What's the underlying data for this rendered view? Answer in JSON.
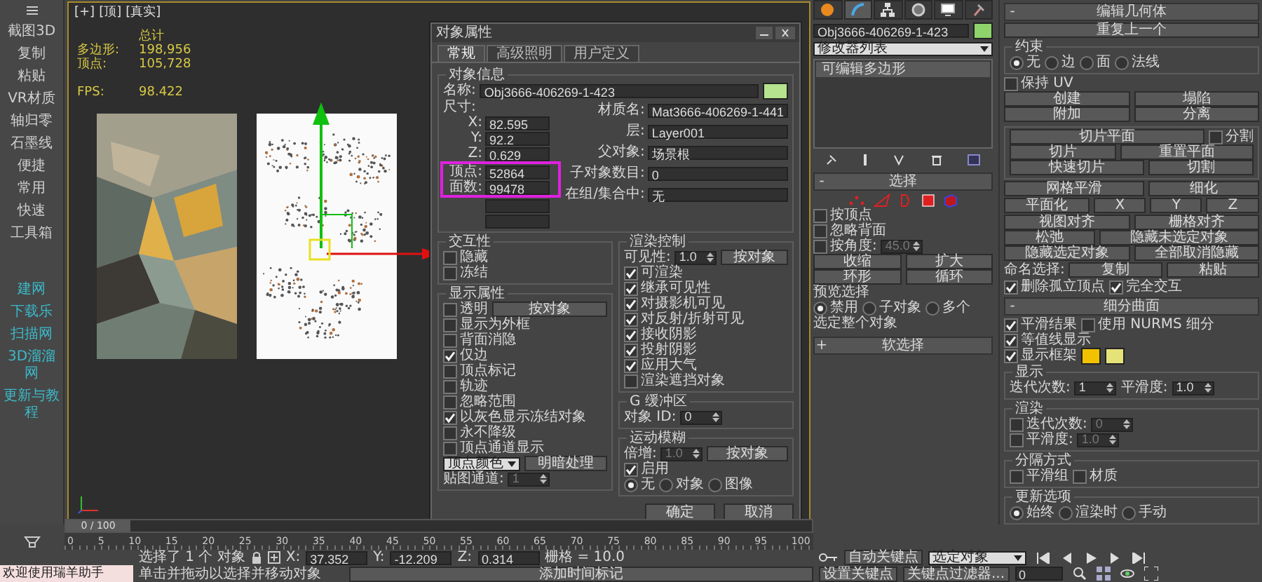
{
  "sidebar": {
    "items": [
      {
        "label": "截图3D",
        "kind": "tool"
      },
      {
        "label": "复制",
        "kind": "tool"
      },
      {
        "label": "粘贴",
        "kind": "tool"
      },
      {
        "label": "VR材质",
        "kind": "tool"
      },
      {
        "label": "轴归零",
        "kind": "tool"
      },
      {
        "label": "石墨线",
        "kind": "tool"
      },
      {
        "label": "便捷",
        "kind": "tool"
      },
      {
        "label": "常用",
        "kind": "tool"
      },
      {
        "label": "快速",
        "kind": "tool"
      },
      {
        "label": "工具箱",
        "kind": "tool"
      },
      {
        "label": "建网",
        "kind": "link"
      },
      {
        "label": "下载乐",
        "kind": "link"
      },
      {
        "label": "扫描网",
        "kind": "link"
      },
      {
        "label": "3D溜溜网",
        "kind": "link"
      },
      {
        "label": "更新与教程",
        "kind": "link"
      }
    ]
  },
  "viewport": {
    "labels": [
      "[+]",
      "[顶]",
      "[真实]"
    ],
    "stats": {
      "title": "总计",
      "rows": [
        {
          "label": "多边形:",
          "value": "198,956"
        },
        {
          "label": "顶点:",
          "value": "105,728"
        }
      ],
      "fps": {
        "label": "FPS:",
        "value": "98.422"
      }
    }
  },
  "dialog": {
    "title": "对象属性",
    "tabs": [
      {
        "label": "常规",
        "selected": true
      },
      {
        "label": "高级照明",
        "selected": false
      },
      {
        "label": "用户定义",
        "selected": false
      }
    ],
    "info": {
      "title": "对象信息",
      "name_label": "名称:",
      "name": "Obj3666-406269-1-423",
      "color": "#b6e38e",
      "dims_label": "尺寸:",
      "dims": [
        {
          "kind": "value",
          "label": "X:",
          "value": "82.595",
          "highlighted": false
        },
        {
          "kind": "value",
          "label": "Y:",
          "value": "92.2",
          "highlighted": false
        },
        {
          "kind": "value",
          "label": "Z:",
          "value": "0.629",
          "highlighted": false
        },
        {
          "kind": "value",
          "label": "顶点:",
          "value": "52864",
          "highlighted": true
        },
        {
          "kind": "value",
          "label": "面数:",
          "value": "99478",
          "highlighted": true
        },
        {
          "kind": "blank",
          "highlighted": false
        },
        {
          "kind": "blank",
          "highlighted": false
        }
      ],
      "fields": [
        {
          "label": "材质名:",
          "value": "Mat3666-406269-1-441"
        },
        {
          "label": "层:",
          "value": "Layer001"
        },
        {
          "label": "父对象:",
          "value": "场景根"
        },
        {
          "label": "子对象数目:",
          "value": "0"
        },
        {
          "label": "在组/集合中:",
          "value": "无"
        }
      ]
    },
    "left_groups": [
      {
        "kind": "frame",
        "title": "交互性",
        "rows": [
          [
            {
              "kind": "check",
              "label": "隐藏",
              "checked": false
            }
          ],
          [
            {
              "kind": "check",
              "label": "冻结",
              "checked": false
            }
          ]
        ]
      },
      {
        "kind": "frame",
        "title": "显示属性",
        "rows": [
          [
            {
              "kind": "check",
              "label": "透明",
              "checked": false
            },
            {
              "kind": "button",
              "label": "按对象"
            }
          ],
          [
            {
              "kind": "check",
              "label": "显示为外框",
              "checked": false
            }
          ],
          [
            {
              "kind": "check",
              "label": "背面消隐",
              "checked": false
            }
          ],
          [
            {
              "kind": "check",
              "label": "仅边",
              "checked": true
            }
          ],
          [
            {
              "kind": "check",
              "label": "顶点标记",
              "checked": false
            }
          ],
          [
            {
              "kind": "check",
              "label": "轨迹",
              "checked": false
            }
          ],
          [
            {
              "kind": "check",
              "label": "忽略范围",
              "checked": false
            }
          ],
          [
            {
              "kind": "check",
              "label": "以灰色显示冻结对象",
              "checked": true
            }
          ],
          [
            {
              "kind": "check",
              "label": "永不降级",
              "checked": false
            }
          ],
          [
            {
              "kind": "check",
              "label": "顶点通道显示",
              "checked": false
            }
          ],
          [
            {
              "kind": "dropdown",
              "label": "顶点颜色"
            },
            {
              "kind": "button",
              "label": "明暗处理"
            }
          ],
          [
            {
              "kind": "label",
              "label": "贴图通道:"
            },
            {
              "kind": "spinner",
              "value": "1",
              "disabled": true
            }
          ]
        ]
      }
    ],
    "right_groups": [
      {
        "kind": "frame",
        "title": "渲染控制",
        "rows": [
          [
            {
              "kind": "label",
              "label": "可见性:"
            },
            {
              "kind": "spinner",
              "value": "1.0",
              "disabled": false
            },
            {
              "kind": "button",
              "label": "按对象"
            }
          ],
          [
            {
              "kind": "check",
              "label": "可渲染",
              "checked": true
            }
          ],
          [
            {
              "kind": "check",
              "label": "继承可见性",
              "checked": true
            }
          ],
          [
            {
              "kind": "check",
              "label": "对摄影机可见",
              "checked": true
            }
          ],
          [
            {
              "kind": "check",
              "label": "对反射/折射可见",
              "checked": true
            }
          ],
          [
            {
              "kind": "check",
              "label": "接收阴影",
              "checked": true
            }
          ],
          [
            {
              "kind": "check",
              "label": "投射阴影",
              "checked": true
            }
          ],
          [
            {
              "kind": "check",
              "label": "应用大气",
              "checked": true
            }
          ],
          [
            {
              "kind": "check",
              "label": "渲染遮挡对象",
              "checked": false
            }
          ]
        ]
      },
      {
        "kind": "frame",
        "title": "G 缓冲区",
        "rows": [
          [
            {
              "kind": "label",
              "label": "对象 ID:"
            },
            {
              "kind": "spinner",
              "value": "0",
              "disabled": false
            }
          ]
        ]
      },
      {
        "kind": "frame",
        "title": "运动模糊",
        "rows": [
          [
            {
              "kind": "label",
              "label": "倍增:"
            },
            {
              "kind": "spinner",
              "value": "1.0",
              "disabled": true
            },
            {
              "kind": "button",
              "label": "按对象"
            }
          ],
          [
            {
              "kind": "check",
              "label": "启用",
              "checked": true
            }
          ],
          [
            {
              "kind": "radio",
              "label": "无",
              "selected": true
            },
            {
              "kind": "radio",
              "label": "对象",
              "selected": false
            },
            {
              "kind": "radio",
              "label": "图像",
              "selected": false
            }
          ]
        ]
      }
    ],
    "buttons": [
      "确定",
      "取消"
    ]
  },
  "right_panel": {
    "tabs": [
      {
        "kind": "create",
        "selected": false
      },
      {
        "kind": "modify",
        "selected": true
      },
      {
        "kind": "hierarchy",
        "selected": false
      },
      {
        "kind": "motion",
        "selected": false
      },
      {
        "kind": "display",
        "selected": false
      },
      {
        "kind": "utilities",
        "selected": false
      }
    ],
    "name": "Obj3666-406269-1-423",
    "color": "#8fd46a",
    "modifier_list": "修改器列表",
    "stack": [
      {
        "label": "可编辑多边形",
        "selected": true
      }
    ],
    "left_groups": [
      {
        "kind": "rollout",
        "sign": "-",
        "title": "选择",
        "rows": [
          [
            {
              "kind": "subobject_icons"
            }
          ],
          [
            {
              "kind": "check",
              "label": "按顶点",
              "checked": false
            }
          ],
          [
            {
              "kind": "check",
              "label": "忽略背面",
              "checked": false
            }
          ],
          [
            {
              "kind": "check",
              "label": "按角度:",
              "checked": false
            },
            {
              "kind": "spinner",
              "value": "45.0",
              "disabled": true
            }
          ],
          [
            {
              "kind": "button",
              "label": "收缩"
            },
            {
              "kind": "button",
              "label": "扩大"
            }
          ],
          [
            {
              "kind": "button",
              "label": "环形"
            },
            {
              "kind": "button",
              "label": "循环"
            }
          ],
          [
            {
              "kind": "label",
              "label": "预览选择"
            }
          ],
          [
            {
              "kind": "radio",
              "label": "禁用",
              "selected": true
            },
            {
              "kind": "radio",
              "label": "子对象",
              "selected": false
            },
            {
              "kind": "radio",
              "label": "多个",
              "selected": false
            }
          ],
          [
            {
              "kind": "label",
              "label": "选定整个对象"
            }
          ]
        ]
      },
      {
        "kind": "rollout",
        "sign": "+",
        "title": "软选择"
      }
    ],
    "right_groups": [
      {
        "kind": "rollout",
        "sign": "-",
        "title": "编辑几何体",
        "rows": [
          [
            {
              "kind": "button",
              "label": "重复上一个"
            }
          ]
        ]
      },
      {
        "kind": "frame",
        "title": "约束",
        "rows": [
          [
            {
              "kind": "radio",
              "label": "无",
              "selected": true
            },
            {
              "kind": "radio",
              "label": "边",
              "selected": false
            },
            {
              "kind": "radio",
              "label": "面",
              "selected": false
            },
            {
              "kind": "radio",
              "label": "法线",
              "selected": false
            }
          ]
        ]
      },
      {
        "kind": "plain",
        "rows": [
          [
            {
              "kind": "check",
              "label": "保持 UV",
              "checked": false
            }
          ],
          [
            {
              "kind": "button",
              "label": "创建"
            },
            {
              "kind": "button",
              "label": "塌陷"
            }
          ],
          [
            {
              "kind": "button",
              "label": "附加"
            },
            {
              "kind": "button",
              "label": "分离"
            }
          ]
        ]
      },
      {
        "kind": "frame",
        "rows": [
          [
            {
              "kind": "button",
              "label": "切片平面"
            },
            {
              "kind": "check",
              "label": "分割",
              "checked": false
            }
          ],
          [
            {
              "kind": "button",
              "label": "切片"
            },
            {
              "kind": "button",
              "label": "重置平面"
            }
          ],
          [
            {
              "kind": "button",
              "label": "快速切片"
            },
            {
              "kind": "button",
              "label": "切割"
            }
          ]
        ]
      },
      {
        "kind": "plain",
        "rows": [
          [
            {
              "kind": "button",
              "label": "网格平滑"
            },
            {
              "kind": "button",
              "label": "细化"
            }
          ]
        ]
      },
      {
        "kind": "plain",
        "rows": [
          [
            {
              "kind": "button",
              "label": "平面化"
            },
            {
              "kind": "button",
              "label": "X"
            },
            {
              "kind": "button",
              "label": "Y"
            },
            {
              "kind": "button",
              "label": "Z"
            }
          ]
        ]
      },
      {
        "kind": "plain",
        "rows": [
          [
            {
              "kind": "button",
              "label": "视图对齐"
            },
            {
              "kind": "button",
              "label": "栅格对齐"
            }
          ],
          [
            {
              "kind": "button",
              "label": "松弛"
            },
            {
              "kind": "button",
              "label": "隐藏未选定对象"
            }
          ],
          [
            {
              "kind": "button",
              "label": "隐藏选定对象"
            },
            {
              "kind": "button",
              "label": "全部取消隐藏"
            }
          ]
        ]
      },
      {
        "kind": "plain",
        "rows": [
          [
            {
              "kind": "label",
              "label": "命名选择:"
            },
            {
              "kind": "button",
              "label": "复制"
            },
            {
              "kind": "button",
              "label": "粘贴"
            }
          ]
        ]
      },
      {
        "kind": "plain",
        "rows": [
          [
            {
              "kind": "check",
              "label": "删除孤立顶点",
              "checked": true
            },
            {
              "kind": "check",
              "label": "完全交互",
              "checked": true
            }
          ]
        ]
      },
      {
        "kind": "rollout",
        "sign": "-",
        "title": "细分曲面",
        "rows": [
          [
            {
              "kind": "check",
              "label": "平滑结果",
              "checked": true
            },
            {
              "kind": "check",
              "label": "使用 NURMS 细分",
              "checked": false
            }
          ],
          [
            {
              "kind": "check",
              "label": "等值线显示",
              "checked": true
            }
          ],
          [
            {
              "kind": "check",
              "label": "显示框架",
              "checked": true
            },
            {
              "kind": "swatch",
              "color": "#f2c200"
            },
            {
              "kind": "swatch",
              "color": "#e6e27a"
            }
          ]
        ]
      },
      {
        "kind": "frame",
        "title": "显示",
        "rows": [
          [
            {
              "kind": "label",
              "label": "迭代次数:"
            },
            {
              "kind": "spinner",
              "value": "1",
              "disabled": false
            },
            {
              "kind": "label",
              "label": "平滑度:"
            },
            {
              "kind": "spinner",
              "value": "1.0",
              "disabled": false
            }
          ]
        ]
      },
      {
        "kind": "frame",
        "title": "渲染",
        "rows": [
          [
            {
              "kind": "check",
              "label": "迭代次数:",
              "checked": false
            },
            {
              "kind": "spinner",
              "value": "0",
              "disabled": true
            }
          ],
          [
            {
              "kind": "check",
              "label": "平滑度:",
              "checked": false
            },
            {
              "kind": "spinner",
              "value": "1.0",
              "disabled": true
            }
          ]
        ]
      },
      {
        "kind": "frame",
        "title": "分隔方式",
        "rows": [
          [
            {
              "kind": "check",
              "label": "平滑组",
              "checked": false
            },
            {
              "kind": "check",
              "label": "材质",
              "checked": false
            }
          ]
        ]
      },
      {
        "kind": "frame",
        "title": "更新选项",
        "rows": [
          [
            {
              "kind": "radio",
              "label": "始终",
              "selected": true
            },
            {
              "kind": "radio",
              "label": "渲染时",
              "selected": false
            },
            {
              "kind": "radio",
              "label": "手动",
              "selected": false
            }
          ]
        ]
      }
    ]
  },
  "timeline": {
    "position": "0 / 100",
    "level": 0,
    "ticks": [
      "0",
      "5",
      "10",
      "15",
      "20",
      "25",
      "30",
      "35",
      "40",
      "45",
      "50",
      "55",
      "60",
      "65",
      "70",
      "75",
      "80",
      "85",
      "90",
      "95",
      "100"
    ]
  },
  "status": {
    "assistant": "欢迎使用瑞羊助手",
    "selection": "选择了 1 个 对象",
    "prompt": "单击并拖动以选择并移动对象",
    "coords": [
      {
        "label": "X:",
        "value": "37.352"
      },
      {
        "label": "Y:",
        "value": "-12.209"
      },
      {
        "label": "Z:",
        "value": "0.314"
      }
    ],
    "grid": "栅格 = 10.0",
    "add_time_tag": "添加时间标记"
  },
  "key_controls": {
    "auto_key": "自动关键点",
    "key_mode": "选定对象",
    "set_key": "设置关键点",
    "key_filter": "关键点过滤器...",
    "frame": "0"
  }
}
